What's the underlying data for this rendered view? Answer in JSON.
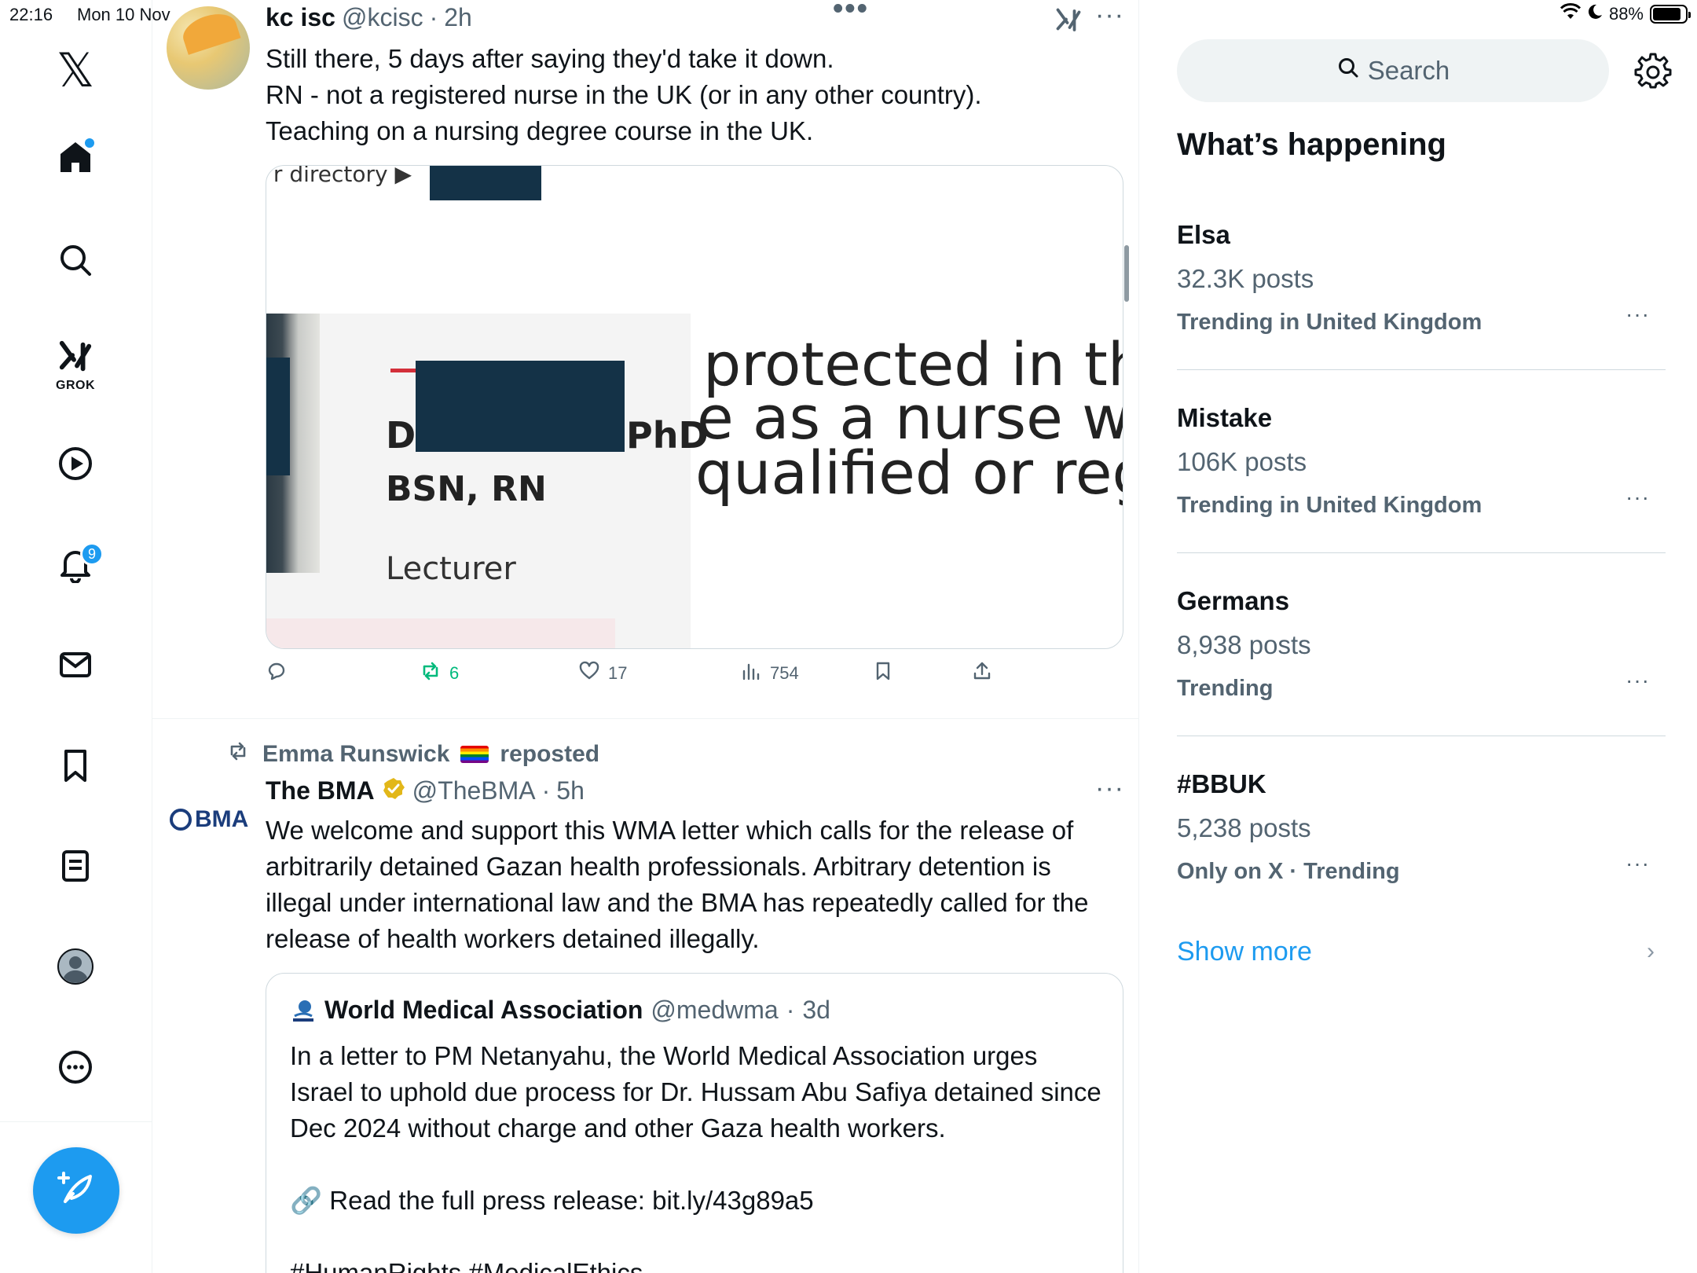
{
  "status_bar": {
    "time": "22:16",
    "date": "Mon 10 Nov",
    "battery": "88%",
    "battery_level": 0.88
  },
  "nav": {
    "logo": "x-logo",
    "grok_label": "GROK",
    "notifications_count": "9",
    "items": [
      "home-icon",
      "search-icon",
      "grok-icon",
      "video-icon",
      "bell-icon",
      "mail-icon",
      "bookmark-icon",
      "list-icon",
      "profile-icon",
      "more-icon"
    ],
    "compose_icon": "feather-plus-icon"
  },
  "post1": {
    "display_name": "kc isc",
    "handle": "@kcisc",
    "dot": "·",
    "time": "2h",
    "text_lines": [
      "Still there, 5 days after saying they'd take it down.",
      "RN - not a registered nurse in the UK (or in any other country).",
      "Teaching on a nursing degree course in the UK."
    ],
    "media": {
      "breadcrumb": "’r directory  ▶",
      "name_initial": "D",
      "suffix": "PhD",
      "credentials": "BSN, RN",
      "role": "Lecturer",
      "big_lines": [
        "protected in the",
        "e as a nurse with",
        "qualified or regis"
      ]
    },
    "stats": {
      "replies": "",
      "reposts": "6",
      "likes": "17",
      "views": "754"
    }
  },
  "post2": {
    "reposter": "Emma Runswick",
    "reposted_label": "reposted",
    "avatar_text": "BMA",
    "display_name": "The BMA",
    "handle": "@TheBMA",
    "dot": "·",
    "time": "5h",
    "text": "We welcome and support this WMA letter which calls for the release of arbitrarily detained Gazan health professionals. Arbitrary detention is illegal under international law and the BMA has repeatedly called for the release of health workers detained illegally.",
    "quote": {
      "display_name": "World Medical Association",
      "handle": "@medwma",
      "dot": "·",
      "time": "3d",
      "text": "In a letter to PM Netanyahu, the World Medical Association urges Israel to uphold due process for Dr. Hussam Abu Safiya detained since Dec 2024 without charge and other Gaza health workers.",
      "link_line": "🔗 Read the full press release: bit.ly/43g89a5",
      "hashtags": "#HumanRights #MedicalEthics"
    }
  },
  "sidebar": {
    "search_placeholder": "Search",
    "section_title": "What’s happening",
    "trends": [
      {
        "name": "Elsa",
        "posts": "32.3K posts",
        "context": "Trending in United Kingdom"
      },
      {
        "name": "Mistake",
        "posts": "106K posts",
        "context": "Trending in United Kingdom"
      },
      {
        "name": "Germans",
        "posts": "8,938 posts",
        "context": "Trending"
      },
      {
        "name": "#BBUK",
        "posts": "5,238 posts",
        "context": "Only on X · Trending"
      }
    ],
    "show_more": "Show more"
  },
  "colors": {
    "accent": "#1d9bf0",
    "repost_green": "#00ba7c",
    "muted": "#536471",
    "redaction": "#143247"
  }
}
